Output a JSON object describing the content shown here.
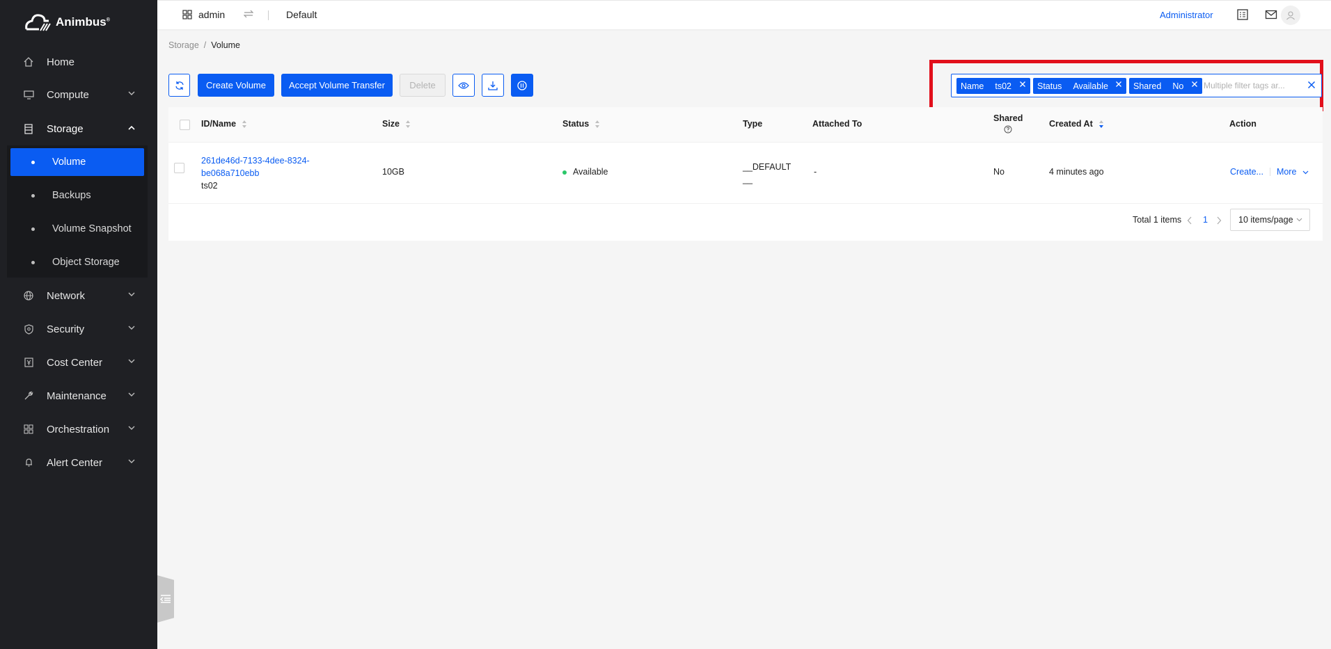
{
  "app": {
    "name": "Animbus"
  },
  "sidebar": {
    "items": [
      {
        "label": "Home",
        "icon": "home-icon"
      },
      {
        "label": "Compute",
        "icon": "monitor-icon"
      },
      {
        "label": "Storage",
        "icon": "storage-icon"
      },
      {
        "label": "Network",
        "icon": "globe-icon"
      },
      {
        "label": "Security",
        "icon": "shield-icon"
      },
      {
        "label": "Cost Center",
        "icon": "yen-icon"
      },
      {
        "label": "Maintenance",
        "icon": "wrench-icon"
      },
      {
        "label": "Orchestration",
        "icon": "grid-icon"
      },
      {
        "label": "Alert Center",
        "icon": "bell-icon"
      }
    ],
    "storage_sub": [
      "Volume",
      "Backups",
      "Volume Snapshot",
      "Object Storage"
    ],
    "active_sub": "Volume"
  },
  "header": {
    "user": "admin",
    "project": "Default",
    "role": "Administrator"
  },
  "breadcrumb": {
    "parent": "Storage",
    "separator": "/",
    "current": "Volume"
  },
  "toolbar": {
    "create": "Create Volume",
    "accept_transfer": "Accept Volume Transfer",
    "delete": "Delete"
  },
  "filter": {
    "tags": [
      {
        "key": "Name",
        "value": "ts02"
      },
      {
        "key": "Status",
        "value": "Available"
      },
      {
        "key": "Shared",
        "value": "No"
      }
    ],
    "placeholder": "Multiple filter tags ar..."
  },
  "table": {
    "columns": {
      "id_name": "ID/Name",
      "size": "Size",
      "status": "Status",
      "type": "Type",
      "attached_to": "Attached To",
      "shared": "Shared",
      "created_at": "Created At",
      "action": "Action"
    },
    "rows": [
      {
        "id_line1": "261de46d-7133-4dee-8324-",
        "id_line2": "be068a710ebb",
        "name": "ts02",
        "size": "10GB",
        "status": "Available",
        "type_line1": "__DEFAULT",
        "type_line2": "__",
        "attached_to": "-",
        "shared": "No",
        "created_at": "4 minutes ago",
        "action_primary": "Create...",
        "action_more": "More"
      }
    ]
  },
  "pagination": {
    "total": "Total 1 items",
    "page": "1",
    "page_size": "10 items/page"
  },
  "colors": {
    "primary": "#0a5cf2",
    "sidebar": "#1f2024",
    "highlight": "#e20f1b",
    "status_ok": "#2ac769"
  }
}
